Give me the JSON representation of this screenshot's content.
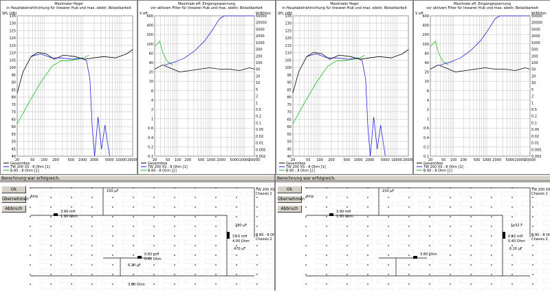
{
  "panels": [
    {
      "id": "left",
      "plots": [
        {
          "title_line1": "Maximaler Pegel",
          "title_line2": "in Hauptabstrahlrichtung für linearen Hub und max. elektr. Belastbarkeit",
          "y_unit": "SPL [dB]",
          "y_ticks": [
            "135",
            "130",
            "125",
            "120",
            "115",
            "110",
            "105",
            "100",
            "95",
            "90",
            "85",
            "80",
            "75",
            "70",
            "65",
            "60",
            "55",
            "50",
            "45",
            "40"
          ],
          "x_ticks": [
            "20",
            "50",
            "100",
            "200",
            "500",
            "1000",
            "2000",
            "5000",
            "10000",
            "20000"
          ],
          "legend": [
            "Gesamtbox",
            "TW 200 XS - 8 Ohm [1]",
            "B 80 - 8 Ohm [2]"
          ]
        },
        {
          "title_line1": "Maximale eff. Eingangsspannung",
          "title_line2": "vor aktivem Filter für linearen Hub und max. elektr. Belastbarkeit",
          "y_unit_left": "V eff",
          "y_unit_right": "W/8Ohm",
          "y_ticks": [
            "600",
            "400",
            "200",
            "100",
            "60",
            "40",
            "20",
            "10",
            "6",
            "4",
            "2",
            "1",
            "0.6",
            "0.4",
            "0.2",
            "0.1"
          ],
          "y2_ticks": [
            "50000",
            "20000",
            "5000",
            "2000",
            "1000",
            "500",
            "200",
            "100",
            "50",
            "20",
            "10",
            "5",
            "2",
            "1",
            "0.5",
            "0.2",
            "0.1",
            "0.05",
            "0.02",
            "0.01",
            "0.005",
            "0.002"
          ],
          "x_ticks": [
            "20",
            "50",
            "100",
            "200",
            "500",
            "1000",
            "2000",
            "5000",
            "10000",
            "20000"
          ],
          "legend": [
            "Gesamtbox",
            "TW 200 XS - 8 Ohm [1]",
            "B 80 - 8 Ohm [2]"
          ]
        }
      ],
      "status": "Berechnung war erfolgreich.",
      "buttons": {
        "ok": "Ok",
        "apply": "Übernehmen",
        "cancel": "Abbruch"
      },
      "schematic": {
        "amp": "Amp",
        "labels": [
          "150 µF",
          "3.90 mH",
          "1.90 Ohm",
          "180 µF",
          "15.0 mH",
          "4.00 Ohm",
          "470 µF",
          "0.82 mH",
          "0.40 Ohm",
          "6.20 µF",
          "3.80 Ohm"
        ],
        "driver1": "TW 200 XS - 8 Ohm",
        "driver1_sub": "Chassis 1",
        "driver2": "B 80 - 8 Ohm",
        "driver2_sub": "Chassis 2"
      }
    },
    {
      "id": "right",
      "plots": [
        {
          "title_line1": "Maximaler Pegel",
          "title_line2": "in Hauptabstrahlrichtung für linearen Hub und max. elektr. Belastbarkeit",
          "y_unit": "SPL [dB]",
          "y_ticks": [
            "135",
            "130",
            "125",
            "120",
            "115",
            "110",
            "105",
            "100",
            "95",
            "90",
            "85",
            "80",
            "75",
            "70",
            "65",
            "60",
            "55",
            "50",
            "45",
            "40"
          ],
          "x_ticks": [
            "20",
            "50",
            "100",
            "200",
            "500",
            "1000",
            "2000",
            "5000",
            "10000",
            "20000"
          ],
          "legend": [
            "Gesamtbox",
            "TW 200 XS - 8 Ohm [1]",
            "B 80 - 8 Ohm [2]"
          ]
        },
        {
          "title_line1": "Maximale eff. Eingangsspannung",
          "title_line2": "vor aktivem Filter für linearen Hub und max. elektr. Belastbarkeit",
          "y_unit_left": "V eff",
          "y_unit_right": "W/8Ohm",
          "y_ticks": [
            "600",
            "400",
            "200",
            "100",
            "60",
            "40",
            "20",
            "10",
            "6",
            "4",
            "2",
            "1",
            "0.6",
            "0.4",
            "0.2",
            "0.1"
          ],
          "y2_ticks": [
            "50000",
            "20000",
            "5000",
            "2000",
            "1000",
            "500",
            "200",
            "100",
            "50",
            "20",
            "10",
            "5",
            "2",
            "1",
            "0.5",
            "0.2",
            "0.1",
            "0.05",
            "0.02",
            "0.01",
            "0.005",
            "0.002"
          ],
          "x_ticks": [
            "20",
            "50",
            "100",
            "200",
            "500",
            "1000",
            "2000",
            "5000",
            "10000",
            "20000"
          ],
          "legend": [
            "Gesamtbox",
            "TW 200 XS - 8 Ohm [1]",
            "B 80 - 8 Ohm [2]"
          ]
        }
      ],
      "status": "Berechnung war erfolgreich.",
      "buttons": {
        "ok": "Ok",
        "apply": "Übernehmen",
        "cancel": "Abbruch"
      },
      "schematic": {
        "amp": "Amp",
        "labels": [
          "150 µF",
          "3.90 mH",
          "1.90 Ohm",
          "1e32 F",
          "0.82 mH",
          "0.40 Ohm",
          "6.20 µF",
          "3.80 Ohm"
        ],
        "driver1": "TW 200 XS - 8 Ohm",
        "driver1_sub": "Chassis 1",
        "driver2": "B 80 - 8 Ohm",
        "driver2_sub": "Chassis 2"
      }
    }
  ],
  "colors": {
    "total": "#000000",
    "tweeter": "#2020e0",
    "woofer": "#20c020"
  }
}
